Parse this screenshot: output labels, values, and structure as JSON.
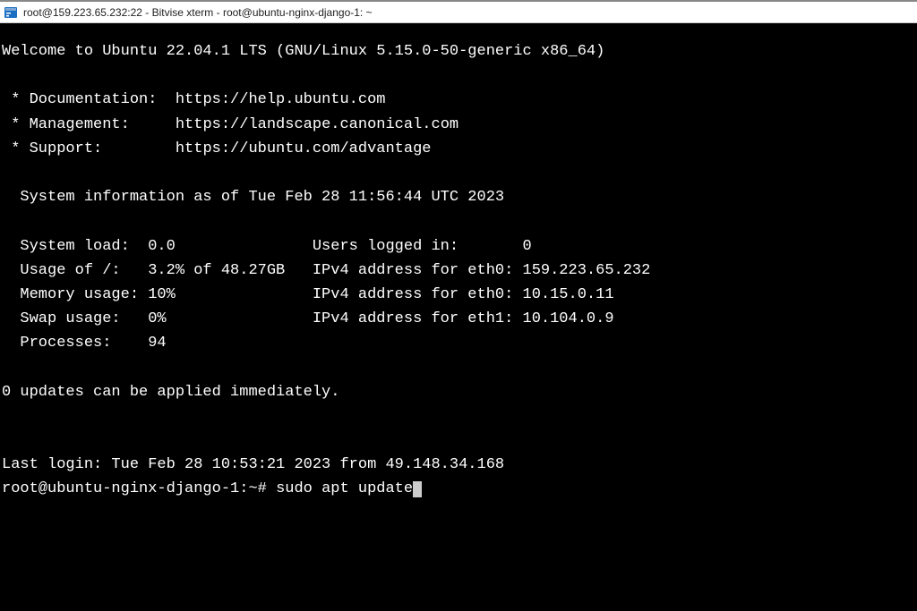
{
  "titlebar": {
    "text": "root@159.223.65.232:22 - Bitvise xterm - root@ubuntu-nginx-django-1: ~"
  },
  "terminal": {
    "welcome": "Welcome to Ubuntu 22.04.1 LTS (GNU/Linux 5.15.0-50-generic x86_64)",
    "links": {
      "doc_label": " * Documentation:  ",
      "doc_url": "https://help.ubuntu.com",
      "mgmt_label": " * Management:     ",
      "mgmt_url": "https://landscape.canonical.com",
      "sup_label": " * Support:        ",
      "sup_url": "https://ubuntu.com/advantage"
    },
    "sysinfo_header": "  System information as of Tue Feb 28 11:56:44 UTC 2023",
    "rows": {
      "r1l": "  System load:  0.0               ",
      "r1r": "Users logged in:       0",
      "r2l": "  Usage of /:   3.2% of 48.27GB   ",
      "r2r": "IPv4 address for eth0: 159.223.65.232",
      "r3l": "  Memory usage: 10%               ",
      "r3r": "IPv4 address for eth0: 10.15.0.11",
      "r4l": "  Swap usage:   0%                ",
      "r4r": "IPv4 address for eth1: 10.104.0.9",
      "r5": "  Processes:    94"
    },
    "updates": "0 updates can be applied immediately.",
    "lastlogin": "Last login: Tue Feb 28 10:53:21 2023 from 49.148.34.168",
    "prompt": "root@ubuntu-nginx-django-1:~# ",
    "command": "sudo apt update"
  }
}
